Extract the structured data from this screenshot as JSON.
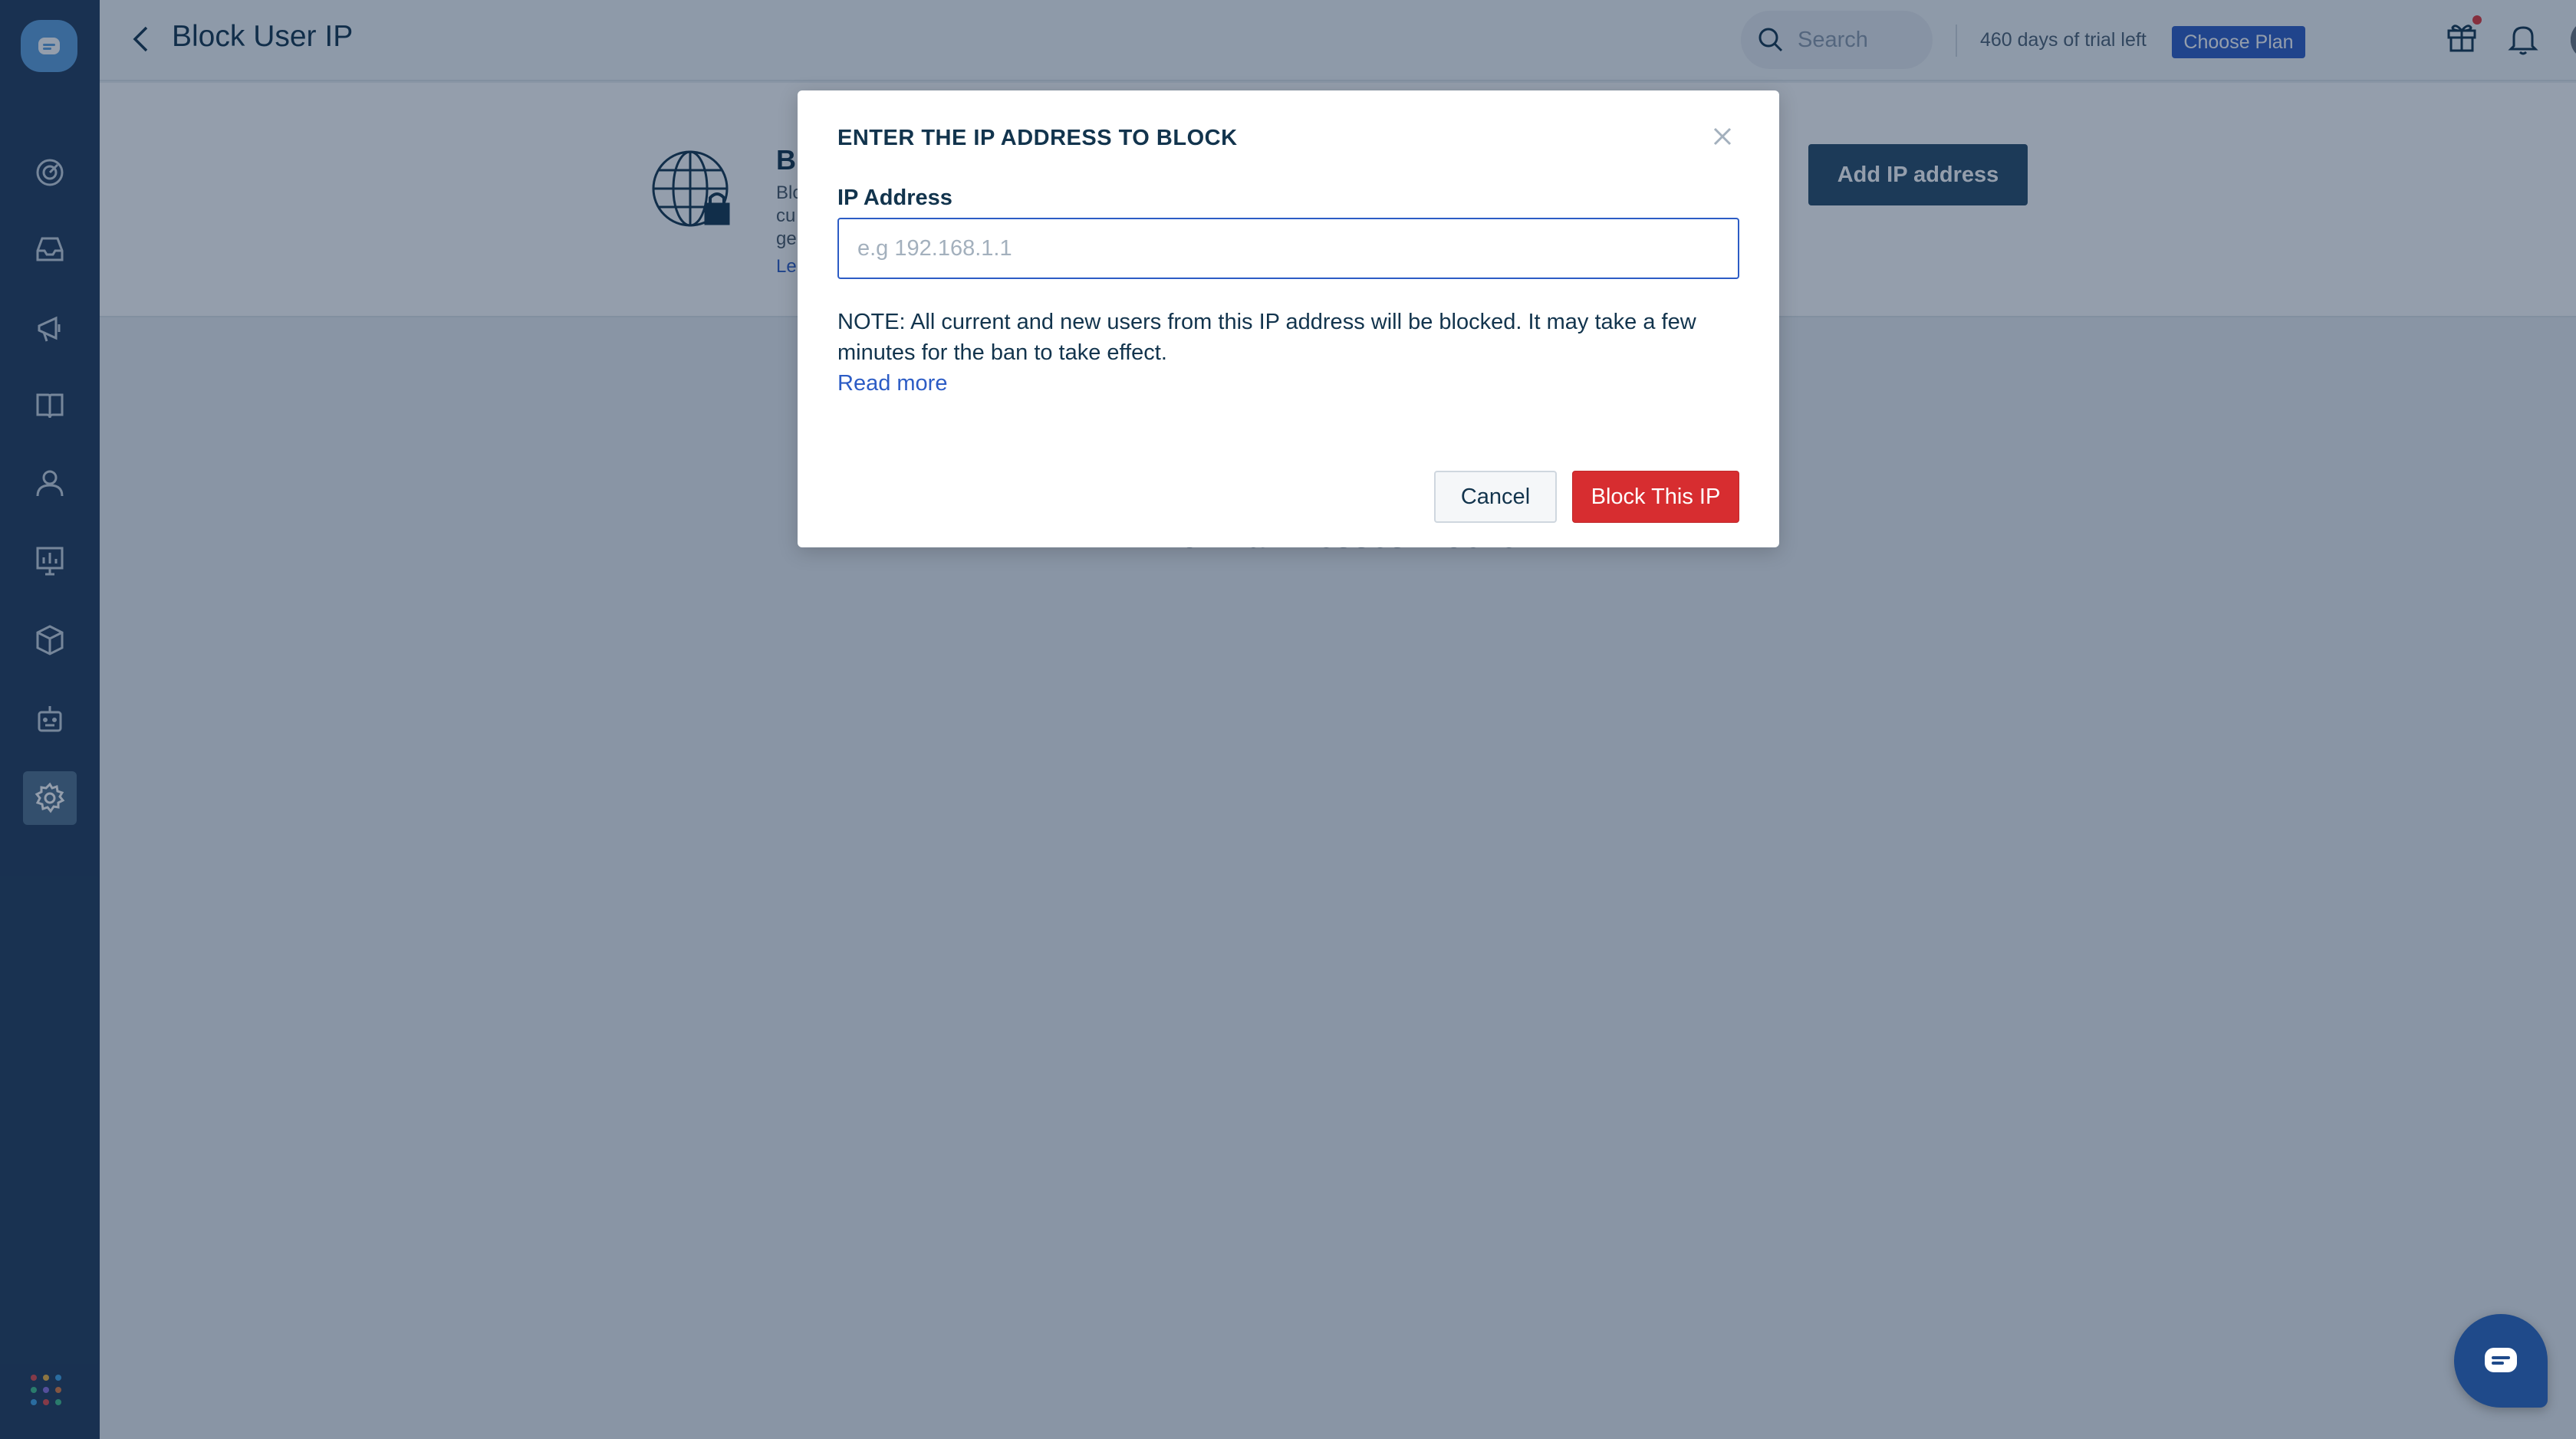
{
  "header": {
    "title": "Block User IP",
    "search_placeholder": "Search",
    "trial_text": "460 days of trial left",
    "choose_plan_label": "Choose Plan"
  },
  "page": {
    "intro_title": "Bl",
    "intro_lines": [
      "Blo",
      "cu",
      "ge",
      "Le"
    ],
    "add_ip_label": "Add IP address",
    "empty_text": "No IP addresses blocked"
  },
  "modal": {
    "title": "ENTER THE IP ADDRESS TO BLOCK",
    "field_label": "IP Address",
    "input_placeholder": "e.g 192.168.1.1",
    "input_value": "",
    "note": "NOTE: All current and new users from this IP address will be blocked. It may take a few minutes for the ban to take effect.",
    "read_more_label": "Read more",
    "cancel_label": "Cancel",
    "confirm_label": "Block This IP"
  },
  "colors": {
    "sidebar_bg": "#1f3a5a",
    "primary": "#2c5cc5",
    "danger": "#d72d30",
    "overlay": "rgba(18,40,70,0.45)"
  },
  "sidebar": {
    "items": [
      {
        "icon": "dashboard-icon"
      },
      {
        "icon": "inbox-icon"
      },
      {
        "icon": "campaigns-icon"
      },
      {
        "icon": "knowledge-base-icon"
      },
      {
        "icon": "contacts-icon"
      },
      {
        "icon": "reports-icon"
      },
      {
        "icon": "apps-box-icon"
      },
      {
        "icon": "bot-icon"
      },
      {
        "icon": "settings-icon",
        "active": true
      }
    ]
  }
}
